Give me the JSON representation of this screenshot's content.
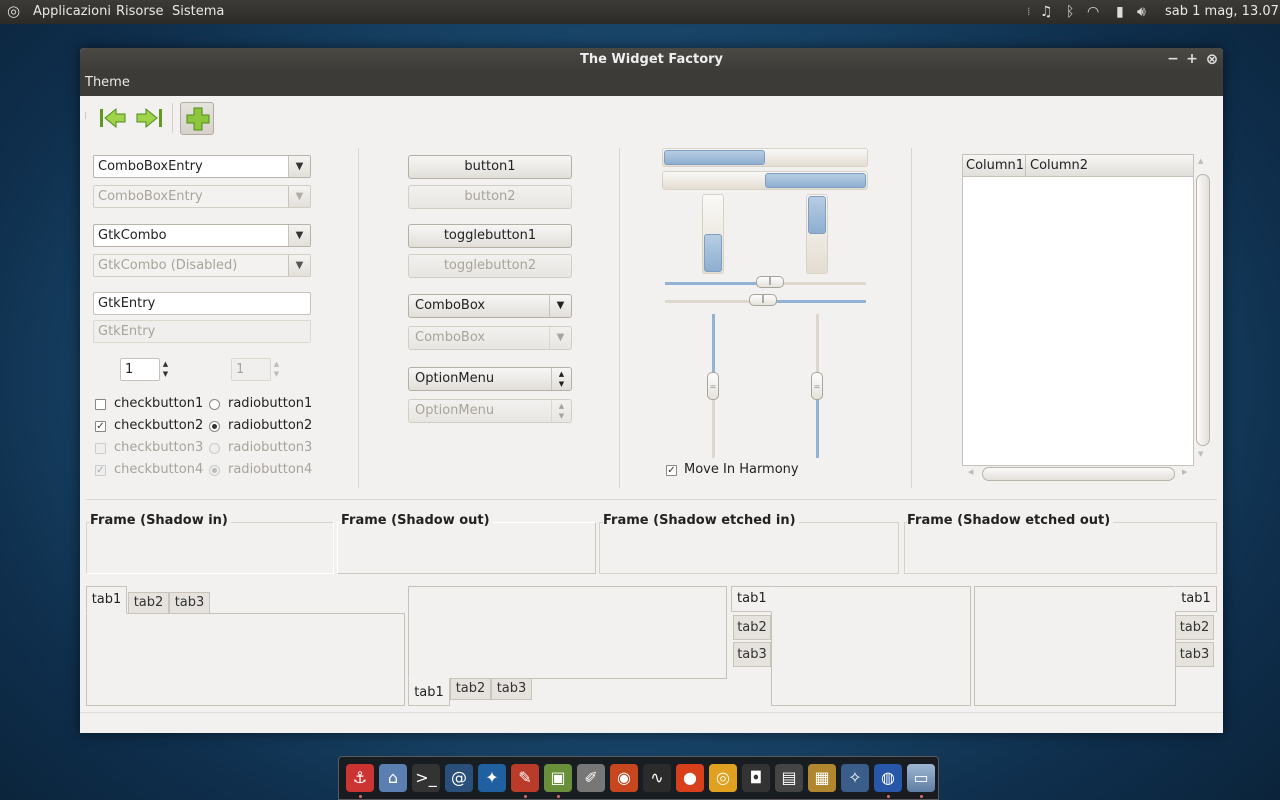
{
  "top_panel": {
    "menus": [
      "Applicazioni",
      "Risorse",
      "Sistema"
    ],
    "clock": "sab  1 mag, 13.07",
    "icons": [
      "logo-icon",
      "music-icon",
      "bluetooth-icon",
      "wifi-icon",
      "battery-icon",
      "volume-icon"
    ]
  },
  "window": {
    "title": "The Widget Factory",
    "menu": [
      "Theme"
    ],
    "controls": [
      "−",
      "+",
      "⊗"
    ]
  },
  "toolbar": {
    "icons": [
      "go-first-icon",
      "go-last-icon",
      "add-icon"
    ]
  },
  "left": {
    "comboentry1": "ComboBoxEntry",
    "comboentry2": "ComboBoxEntry",
    "gtkcombo1": "GtkCombo",
    "gtkcombo2": "GtkCombo (Disabled)",
    "entry1": "GtkEntry",
    "entry2": "GtkEntry",
    "spin1": "1",
    "spin2": "1",
    "checks": [
      "checkbutton1",
      "checkbutton2",
      "checkbutton3",
      "checkbutton4"
    ],
    "radios": [
      "radiobutton1",
      "radiobutton2",
      "radiobutton3",
      "radiobutton4"
    ]
  },
  "middle": {
    "button1": "button1",
    "button2": "button2",
    "toggle1": "togglebutton1",
    "toggle2": "togglebutton2",
    "combobox1": "ComboBox",
    "combobox2": "ComboBox",
    "option1": "OptionMenu",
    "option2": "OptionMenu"
  },
  "progress": {
    "h1": 0.5,
    "h2": 0.5,
    "v1": 0.5,
    "v2": 0.5,
    "hscale1": 0.52,
    "hscale2": 0.49,
    "vscale1": 0.5,
    "vscale2": 0.5
  },
  "harmony_label": "Move In Harmony",
  "treeview": {
    "columns": [
      "Column1",
      "Column2"
    ]
  },
  "frames": [
    "Frame (Shadow in)",
    "Frame (Shadow out)",
    "Frame (Shadow etched in)",
    "Frame (Shadow etched out)"
  ],
  "notebooks": {
    "tabs": [
      "tab1",
      "tab2",
      "tab3"
    ]
  },
  "dock": {
    "icons": [
      "anchor-icon",
      "home-folder-icon",
      "terminal-icon",
      "email-icon",
      "network-icon",
      "text-editor-icon",
      "image-viewer-icon",
      "notes-icon",
      "game-icon",
      "system-monitor-icon",
      "firefox-icon",
      "ubuntu-one-icon",
      "speaker-icon",
      "video-editor-icon",
      "archive-icon",
      "compass-icon",
      "web-browser-icon",
      "window-icon"
    ]
  }
}
